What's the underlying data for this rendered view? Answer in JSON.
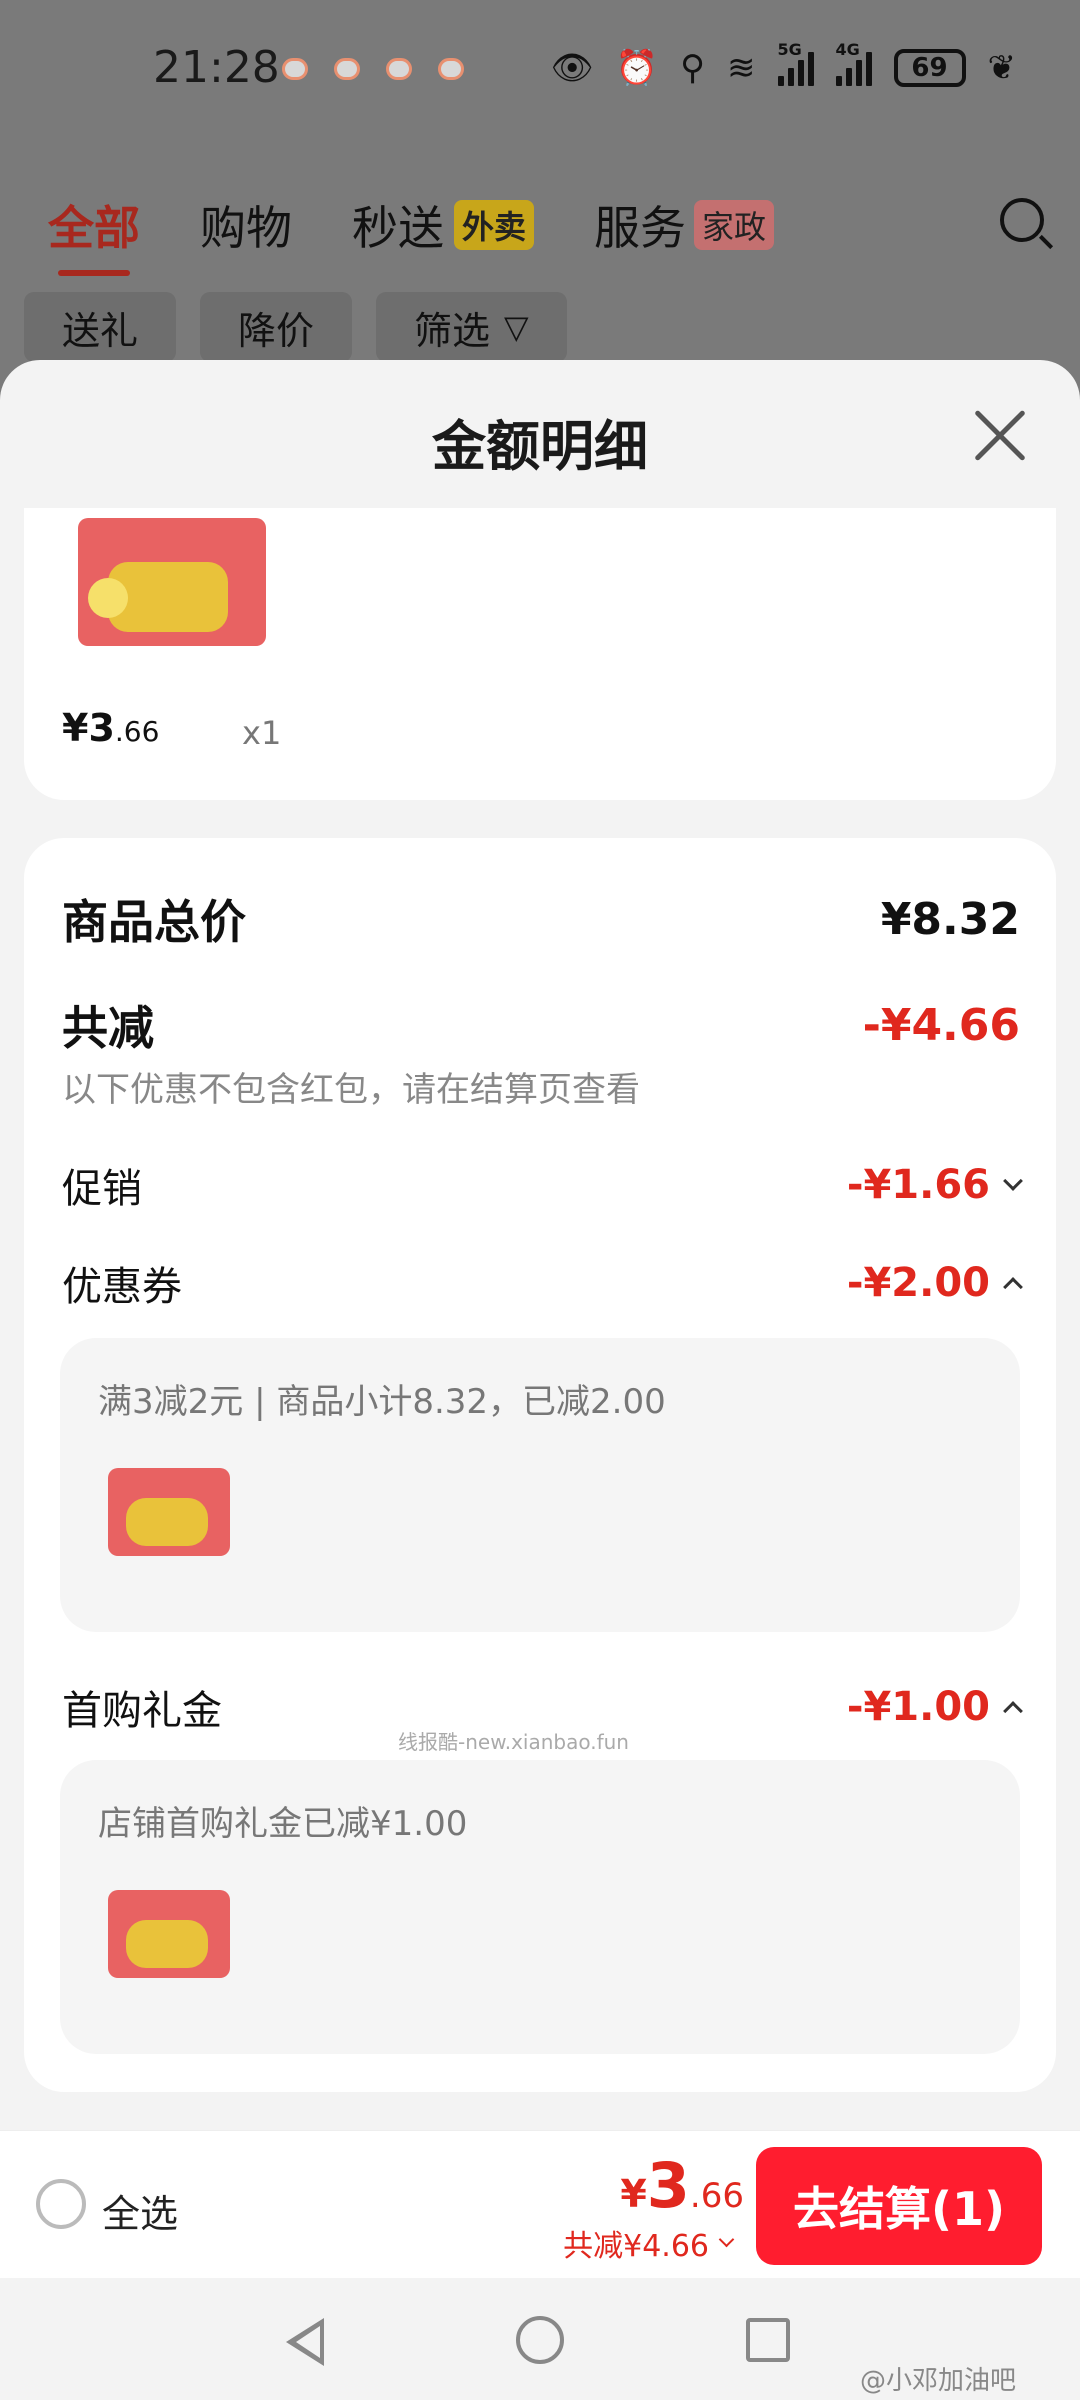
{
  "status": {
    "time": "21:28",
    "net1": "5G",
    "net2": "4G",
    "battery": "69"
  },
  "tabs": [
    {
      "label": "全部"
    },
    {
      "label": "购物"
    },
    {
      "label": "秒送",
      "tag": "外卖"
    },
    {
      "label": "服务",
      "tag": "家政"
    }
  ],
  "chips": [
    "送礼",
    "降价",
    "筛选"
  ],
  "sheet": {
    "title": "金额明细"
  },
  "product": {
    "price_int": "¥3",
    "price_dec": ".66",
    "qty": "x1"
  },
  "details": {
    "total_label": "商品总价",
    "total_value": "¥8.32",
    "discount_label": "共减",
    "discount_value": "-¥4.66",
    "note": "以下优惠不包含红包，请在结算页查看",
    "promo_label": "促销",
    "promo_value": "-¥1.66",
    "coupon_label": "优惠券",
    "coupon_value": "-¥2.00",
    "coupon_desc": "满3减2元 | 商品小计8.32，已减2.00",
    "gift_label": "首购礼金",
    "gift_value": "-¥1.00",
    "gift_desc": "店铺首购礼金已减¥1.00"
  },
  "watermark": "线报酷-new.xianbao.fun",
  "bottom": {
    "select_all": "全选",
    "total_cur": "¥",
    "total_int": "3",
    "total_dec": ".66",
    "total_discount": "共减¥4.66",
    "checkout": "去结算(1)"
  },
  "credit": "@小邓加油吧",
  "colors": {
    "accent": "#ff1d2f",
    "discount": "#e0281e"
  }
}
